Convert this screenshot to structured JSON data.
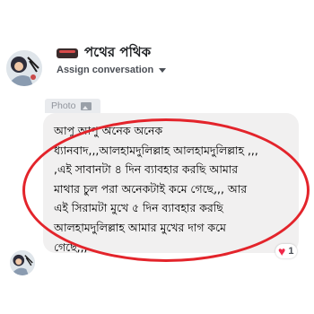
{
  "conversation": {
    "title": "পথের পথিক",
    "assign_label": "Assign conversation"
  },
  "attachment": {
    "label": "Photo"
  },
  "message": {
    "lines": [
      "আপু আপু অনেক অনেক",
      "ধ্যানবাদ,,,আলহামদুলিল্লাহ আলহামদুলিল্লাহ ,,,",
      ",এই সাবানটা ৪ দিন ব্যাবহার করছি আমার",
      "মাথার চুল পরা অনেকটাই কমে গেছে,,, আর",
      "এই সিরামটা মুখে ৫ দিন ব্যাবহার করছি",
      "আলহামদুলিল্লাহ আমার মুখের দাগ কমে",
      "গেছে,,,"
    ]
  },
  "reaction": {
    "icon": "heart-icon",
    "count": "1"
  },
  "colors": {
    "highlight": "#e3242b",
    "bubble": "#f1f0f0",
    "heart": "#f02849"
  }
}
